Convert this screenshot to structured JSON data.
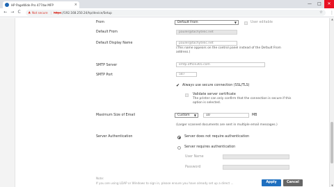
{
  "browser": {
    "tab_title": "HP PageWide Pro 477dw MFP",
    "tab_close": "×",
    "nav_back": "←",
    "nav_forward": "→",
    "nav_reload": "C",
    "security_warning": "Not secure",
    "url_scheme": "https",
    "url_rest": "://192.168.250.24/hp/device/Setup",
    "min": "—",
    "max": "□",
    "close": "✕",
    "menu": "⋮"
  },
  "form": {
    "from": {
      "label": "From",
      "selected": "Default From",
      "user_editable_label": "User editable"
    },
    "default_from": {
      "label": "Default From",
      "value": "pauler@tachytelic.net"
    },
    "default_display_name": {
      "label": "Default Display Name",
      "value": "pauler@tachytelic.net",
      "help": "(This name appears on the control panel instead of the Default From address.)"
    },
    "smtp_server": {
      "label": "SMTP Server",
      "value": "smtp.office365.com"
    },
    "smtp_port": {
      "label": "SMTP Port",
      "value": "587"
    },
    "secure_connection": {
      "label": "Always use secure connection (SSL/TLS)",
      "checked": true
    },
    "validate_certificate": {
      "label": "Validate server certificate",
      "help": "The printer can only confirm that the connection is secure if this option is selected.",
      "checked": false
    },
    "max_email_size": {
      "label": "Maximum Size of Email",
      "selected": "Custom",
      "value": "10",
      "unit": "MB",
      "help": "(Larger scanned documents are sent in multiple email messages.)"
    },
    "server_auth": {
      "label": "Server Authentication",
      "option_none": "Server does not require authentication",
      "option_required": "Server requires authentication",
      "selected": "Server does not require authentication",
      "username_label": "User Name",
      "password_label": "Password"
    },
    "note": {
      "label": "Note:",
      "text": "If you are using LDAP or Windows to sign in, please ensure you have already set up a direct ..."
    }
  },
  "buttons": {
    "apply": "Apply",
    "cancel": "Cancel"
  },
  "colors": {
    "apply": "#1e6fbf",
    "cancel": "#666666",
    "warning": "#d93025"
  }
}
